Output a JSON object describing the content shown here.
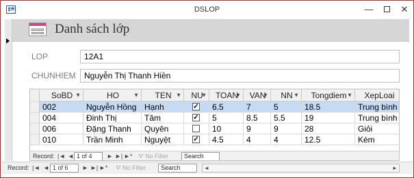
{
  "window": {
    "title": "DSLOP",
    "minimize_glyph": "—",
    "close_glyph": "✕"
  },
  "form": {
    "title": "Danh sách lớp",
    "fields": {
      "lop_label": "LOP",
      "lop_value": "12A1",
      "chunhiem_label": "CHUNHIEM",
      "chunhiem_value": "Nguyễn Thị Thanh Hiền"
    }
  },
  "subform": {
    "columns": [
      "SoBD",
      "HO",
      "TEN",
      "NU",
      "TOAN",
      "VAN",
      "NN",
      "Tongdiem",
      "XepLoai"
    ],
    "rows": [
      {
        "SoBD": "002",
        "HO": "Nguyễn Hồng",
        "TEN": "Hạnh",
        "NU": true,
        "TOAN": "6.5",
        "VAN": "7",
        "NN": "5",
        "Tongdiem": "18.5",
        "XepLoai": "Trung bình",
        "selected": true
      },
      {
        "SoBD": "004",
        "HO": "Đinh Thị",
        "TEN": "Tâm",
        "NU": true,
        "TOAN": "5",
        "VAN": "8.5",
        "NN": "5.5",
        "Tongdiem": "19",
        "XepLoai": "Trung bình",
        "selected": false
      },
      {
        "SoBD": "006",
        "HO": "Đặng Thanh",
        "TEN": "Quyên",
        "NU": false,
        "TOAN": "10",
        "VAN": "9",
        "NN": "9",
        "Tongdiem": "28",
        "XepLoai": "Giỏi",
        "selected": false
      },
      {
        "SoBD": "010",
        "HO": "Trần Minh",
        "TEN": "Nguyệt",
        "NU": true,
        "TOAN": "4.5",
        "VAN": "4",
        "NN": "4",
        "Tongdiem": "12.5",
        "XepLoai": "Kém",
        "selected": false
      }
    ],
    "nav": {
      "record_label": "Record:",
      "position": "1 of 4",
      "filter_label": "No Filter",
      "search_placeholder": "Search"
    }
  },
  "main_nav": {
    "record_label": "Record:",
    "position": "1 of 6",
    "filter_label": "No Filter",
    "search_placeholder": "Search"
  },
  "icons": {
    "first": "|◄",
    "prev": "◄",
    "next": "►",
    "last": "►|",
    "new": "►*",
    "check": "✓"
  },
  "colors": {
    "selected_row": "#c6dbf3",
    "header_band": "#d6d6d6",
    "form_icon_accent": "#c34b86"
  }
}
